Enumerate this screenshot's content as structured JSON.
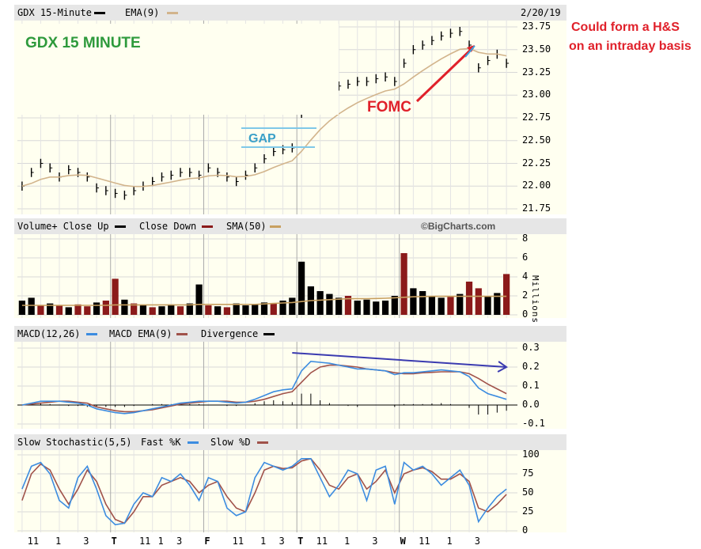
{
  "price_header": {
    "symbol_label": "GDX 15-Minute",
    "ema_label": "EMA(9)",
    "date": "2/20/19"
  },
  "volume_header": {
    "vol_label": "Volume+ Close Up",
    "close_down_label": "Close Down",
    "sma_label": "SMA(50)",
    "watermark": "©BigCharts.com"
  },
  "macd_header": {
    "macd_label": "MACD(12,26)",
    "macd_ema_label": "MACD EMA(9)",
    "divergence_label": "Divergence"
  },
  "stoch_header": {
    "label": "Slow Stochastic(5,5)",
    "fast_label": "Fast %K",
    "slow_label": "Slow %D"
  },
  "annotations": {
    "title": "GDX 15 MINUTE",
    "gap": "GAP",
    "fomc": "FOMC",
    "hs_line1": "Could form a H&S",
    "hs_line2": "on an intraday basis"
  },
  "volume_unit": "Millions",
  "x_axis_labels": [
    {
      "text": "11",
      "bold": false
    },
    {
      "text": "1",
      "bold": false
    },
    {
      "text": "3",
      "bold": false
    },
    {
      "text": "T",
      "bold": true
    },
    {
      "text": "11",
      "bold": false
    },
    {
      "text": "1",
      "bold": false
    },
    {
      "text": "3",
      "bold": false
    },
    {
      "text": "F",
      "bold": true
    },
    {
      "text": "11",
      "bold": false
    },
    {
      "text": "1",
      "bold": false
    },
    {
      "text": "3",
      "bold": false
    },
    {
      "text": "T",
      "bold": true
    },
    {
      "text": "11",
      "bold": false
    },
    {
      "text": "1",
      "bold": false
    },
    {
      "text": "3",
      "bold": false
    },
    {
      "text": "W",
      "bold": true
    },
    {
      "text": "11",
      "bold": false
    },
    {
      "text": "1",
      "bold": false
    },
    {
      "text": "3",
      "bold": false
    }
  ],
  "colors": {
    "panel_bg": "#fffff0",
    "header_bg": "#e6e6e6",
    "price_bar": "#000000",
    "ema": "#d2b48c",
    "vol_up": "#000000",
    "vol_down": "#8b1a1a",
    "sma": "#c8a060",
    "macd": "#3c8ce0",
    "macd_ema": "#a0524a",
    "fast_k": "#3c8ce0",
    "slow_d": "#a0524a",
    "title_green": "#2e9a3c",
    "gap_blue": "#3aa0c8",
    "fomc_red": "#e0202a",
    "trend_arrow": "#3a3ab0"
  },
  "chart_data": [
    {
      "type": "line",
      "name": "price",
      "ylim": [
        21.75,
        23.75
      ],
      "y_ticks": [
        "23.75",
        "23.50",
        "23.25",
        "23.00",
        "22.75",
        "22.50",
        "22.25",
        "22.00",
        "21.75"
      ],
      "values": [
        22.0,
        22.15,
        22.25,
        22.2,
        22.1,
        22.18,
        22.15,
        22.1,
        21.98,
        21.95,
        21.92,
        21.9,
        21.95,
        22.0,
        22.05,
        22.1,
        22.12,
        22.15,
        22.15,
        22.12,
        22.2,
        22.15,
        22.1,
        22.05,
        22.12,
        22.2,
        22.3,
        22.38,
        22.4,
        22.42,
        22.8,
        23.0,
        23.08,
        23.1,
        23.1,
        23.12,
        23.15,
        23.15,
        23.18,
        23.2,
        23.15,
        23.35,
        23.5,
        23.55,
        23.6,
        23.65,
        23.68,
        23.7,
        23.55,
        23.3,
        23.38,
        23.45,
        23.35
      ]
    },
    {
      "type": "bar",
      "name": "volume",
      "ylim": [
        0,
        8
      ],
      "y_ticks": [
        "8",
        "6",
        "4",
        "2",
        "0"
      ],
      "values": [
        1.5,
        1.8,
        1.0,
        1.2,
        1.0,
        0.8,
        1.1,
        0.9,
        1.3,
        1.5,
        3.8,
        1.6,
        1.2,
        1.0,
        0.8,
        0.9,
        1.1,
        0.9,
        1.2,
        3.2,
        1.0,
        0.9,
        0.8,
        1.2,
        1.0,
        1.1,
        1.3,
        1.2,
        1.5,
        1.8,
        5.6,
        3.0,
        2.5,
        2.2,
        1.8,
        2.0,
        1.5,
        1.6,
        1.4,
        1.5,
        2.0,
        6.5,
        2.8,
        2.5,
        2.0,
        1.8,
        1.9,
        2.2,
        3.5,
        2.8,
        2.0,
        2.3,
        4.3
      ],
      "close_up": [
        1,
        1,
        0,
        1,
        0,
        1,
        0,
        0,
        1,
        0,
        0,
        1,
        0,
        1,
        0,
        1,
        1,
        0,
        1,
        1,
        0,
        1,
        0,
        1,
        1,
        1,
        1,
        0,
        1,
        1,
        1,
        1,
        1,
        1,
        1,
        0,
        1,
        1,
        1,
        1,
        1,
        0,
        1,
        1,
        1,
        1,
        0,
        1,
        0,
        0,
        1,
        1,
        0
      ],
      "sma": [
        1.0,
        1.0,
        1.0,
        1.0,
        1.0,
        1.0,
        1.0,
        1.0,
        1.0,
        1.0,
        1.05,
        1.05,
        1.05,
        1.05,
        1.05,
        1.05,
        1.05,
        1.05,
        1.05,
        1.1,
        1.1,
        1.1,
        1.1,
        1.1,
        1.1,
        1.1,
        1.15,
        1.2,
        1.25,
        1.3,
        1.4,
        1.5,
        1.55,
        1.6,
        1.65,
        1.7,
        1.7,
        1.7,
        1.72,
        1.75,
        1.8,
        1.85,
        1.9,
        1.92,
        1.95,
        1.95,
        1.95,
        1.95,
        1.95,
        1.95,
        1.95,
        1.95,
        1.95
      ]
    },
    {
      "type": "line",
      "name": "macd",
      "ylim": [
        -0.1,
        0.3
      ],
      "y_ticks": [
        "0.3",
        "0.2",
        "0.1",
        "0.0",
        "-0.1"
      ],
      "macd": [
        0.0,
        0.01,
        0.02,
        0.02,
        0.02,
        0.015,
        0.01,
        0.0,
        -0.02,
        -0.03,
        -0.04,
        -0.045,
        -0.04,
        -0.03,
        -0.02,
        -0.01,
        0.0,
        0.01,
        0.015,
        0.02,
        0.02,
        0.02,
        0.015,
        0.01,
        0.015,
        0.03,
        0.05,
        0.07,
        0.08,
        0.085,
        0.18,
        0.23,
        0.225,
        0.22,
        0.21,
        0.2,
        0.19,
        0.19,
        0.185,
        0.18,
        0.16,
        0.17,
        0.17,
        0.175,
        0.18,
        0.185,
        0.18,
        0.175,
        0.15,
        0.09,
        0.06,
        0.045,
        0.03
      ],
      "signal": [
        0.0,
        0.005,
        0.01,
        0.015,
        0.02,
        0.02,
        0.015,
        0.01,
        -0.01,
        -0.02,
        -0.03,
        -0.035,
        -0.035,
        -0.03,
        -0.025,
        -0.015,
        -0.005,
        0.005,
        0.01,
        0.015,
        0.02,
        0.02,
        0.02,
        0.015,
        0.015,
        0.02,
        0.03,
        0.045,
        0.06,
        0.07,
        0.12,
        0.17,
        0.2,
        0.21,
        0.21,
        0.205,
        0.2,
        0.19,
        0.185,
        0.18,
        0.17,
        0.165,
        0.165,
        0.17,
        0.172,
        0.175,
        0.175,
        0.175,
        0.165,
        0.14,
        0.11,
        0.085,
        0.06
      ],
      "divergence": [
        0.0,
        0.005,
        0.01,
        0.005,
        0.0,
        -0.005,
        -0.005,
        -0.01,
        -0.01,
        -0.01,
        -0.01,
        -0.01,
        -0.005,
        0.0,
        0.005,
        0.005,
        0.005,
        0.005,
        0.005,
        0.005,
        0.0,
        0.0,
        -0.005,
        -0.005,
        0.0,
        0.01,
        0.02,
        0.025,
        0.02,
        0.015,
        0.06,
        0.06,
        0.025,
        0.01,
        0.0,
        -0.005,
        -0.01,
        0.0,
        0.0,
        0.0,
        -0.01,
        0.005,
        0.005,
        0.005,
        0.008,
        0.01,
        0.005,
        0.0,
        -0.015,
        -0.05,
        -0.05,
        -0.04,
        -0.03
      ],
      "trend_arrow": {
        "from_x": 29,
        "from_y": 0.275,
        "to_x": 52,
        "to_y": 0.2
      }
    },
    {
      "type": "line",
      "name": "slow_stochastic",
      "ylim": [
        0,
        100
      ],
      "y_ticks": [
        "100",
        "75",
        "50",
        "25",
        "0"
      ],
      "fast_k": [
        55,
        85,
        90,
        75,
        40,
        30,
        70,
        85,
        55,
        20,
        8,
        10,
        35,
        50,
        45,
        70,
        65,
        75,
        60,
        40,
        70,
        65,
        30,
        20,
        25,
        70,
        90,
        85,
        80,
        85,
        95,
        95,
        70,
        45,
        60,
        80,
        75,
        40,
        80,
        85,
        35,
        90,
        80,
        85,
        75,
        60,
        70,
        80,
        60,
        12,
        30,
        45,
        55
      ],
      "slow_d": [
        40,
        75,
        88,
        80,
        55,
        35,
        55,
        80,
        65,
        35,
        15,
        10,
        25,
        45,
        45,
        60,
        65,
        70,
        65,
        50,
        60,
        65,
        45,
        30,
        25,
        50,
        80,
        85,
        82,
        83,
        92,
        95,
        80,
        60,
        55,
        70,
        75,
        55,
        65,
        80,
        50,
        75,
        80,
        83,
        78,
        68,
        68,
        75,
        65,
        30,
        25,
        35,
        48
      ]
    }
  ]
}
